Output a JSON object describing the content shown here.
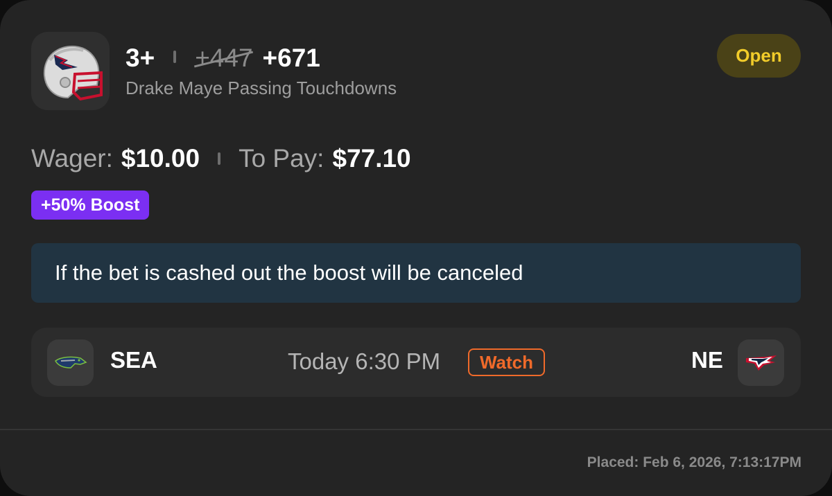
{
  "bet": {
    "line": "3+",
    "old_odds": "+447",
    "new_odds": "+671",
    "market": "Drake Maye Passing Touchdowns",
    "status": "Open",
    "wager_label": "Wager:",
    "wager_value": "$10.00",
    "topay_label": "To Pay:",
    "topay_value": "$77.10",
    "boost": "+50% Boost",
    "notice": "If the bet is cashed out the boost will be canceled"
  },
  "game": {
    "away": "SEA",
    "home": "NE",
    "time": "Today 6:30 PM",
    "watch": "Watch"
  },
  "placed": "Placed: Feb 6, 2026, 7:13:17PM",
  "colors": {
    "card": "#242424",
    "status_bg": "#4a4217",
    "status_text": "#f2cc2a",
    "boost": "#7b2ff2",
    "notice_bg": "#213442",
    "watch": "#f06a2a"
  },
  "icons": {
    "player_team": "patriots-helmet-icon",
    "away_team": "seahawks-logo-icon",
    "home_team": "patriots-logo-icon"
  }
}
